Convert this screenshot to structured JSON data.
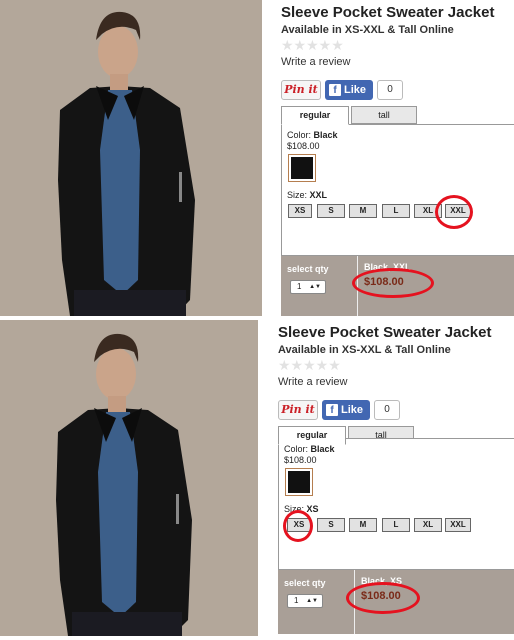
{
  "screenshots": [
    {
      "product": {
        "title": "Sleeve Pocket Sweater Jacket",
        "availability": "Available in XS-XXL & Tall Online",
        "rating_stars": "★★★★★",
        "review_link": "Write a review"
      },
      "social": {
        "pinit_label": "Pin it",
        "like_label": "Like",
        "like_count": "0"
      },
      "tabs": [
        "regular",
        "tall"
      ],
      "color": {
        "label": "Color:",
        "value": "Black",
        "price": "$108.00",
        "swatch_hex": "#111111"
      },
      "size": {
        "label": "Size:",
        "value": "XXL",
        "options": [
          "XS",
          "S",
          "M",
          "L",
          "XL",
          "XXL"
        ],
        "selected": "XXL"
      },
      "purchase": {
        "qty_label": "select qty",
        "qty_value": "1",
        "selection_summary": "Black, XXL",
        "price": "$108.00"
      }
    },
    {
      "product": {
        "title": "Sleeve Pocket Sweater Jacket",
        "availability": "Available in XS-XXL & Tall Online",
        "rating_stars": "★★★★★",
        "review_link": "Write a review"
      },
      "social": {
        "pinit_label": "Pin it",
        "like_label": "Like",
        "like_count": "0"
      },
      "tabs": [
        "regular",
        "tall"
      ],
      "color": {
        "label": "Color:",
        "value": "Black",
        "price": "$108.00",
        "swatch_hex": "#111111"
      },
      "size": {
        "label": "Size:",
        "value": "XS",
        "options": [
          "XS",
          "S",
          "M",
          "L",
          "XL",
          "XXL"
        ],
        "selected": "XS"
      },
      "purchase": {
        "qty_label": "select qty",
        "qty_value": "1",
        "selection_summary": "Black, XS",
        "price": "$108.00"
      }
    }
  ],
  "colors": {
    "annotation_red": "#e5121f",
    "qty_bar": "#a99f97",
    "price_text": "#7a2a18",
    "fb_blue": "#4267b2",
    "pinterest_red": "#cb2027"
  }
}
